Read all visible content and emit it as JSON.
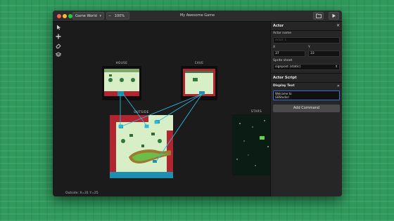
{
  "window": {
    "title": "My Awesome Game"
  },
  "toolbar": {
    "world_select": "Game World",
    "zoom_minus": "−",
    "zoom_value": "100%",
    "zoom_plus": "+",
    "folder_icon": "folder-icon",
    "play_icon": "play-icon"
  },
  "tools": [
    "pointer-icon",
    "add-icon",
    "eraser-icon",
    "layers-icon"
  ],
  "scenes": {
    "house": "HOUSE",
    "cave": "CAVE",
    "outside": "OUTSIDE",
    "stars": "STARS"
  },
  "status": {
    "text": "Outside: X=31 Y=25"
  },
  "panel": {
    "title": "Actor",
    "close": "✕",
    "actor_name_label": "Actor name",
    "actor_name_placeholder": "Actor 1",
    "x_label": "X",
    "x_value": "37",
    "y_label": "Y",
    "y_value": "33",
    "sprite_label": "Sprite sheet",
    "sprite_value": "signpost (static)",
    "script_heading": "Actor Script",
    "command_title": "Display Text",
    "command_close": "✕",
    "text_line1": "Welcome to",
    "text_line2": "GBStudio!",
    "add_command": "Add Command"
  },
  "colors": {
    "accent": "#3c6fd1",
    "link": "#2fb8d8",
    "background": "#2f9a5c",
    "grass": "#d9eec7",
    "wall": "#b12531"
  }
}
